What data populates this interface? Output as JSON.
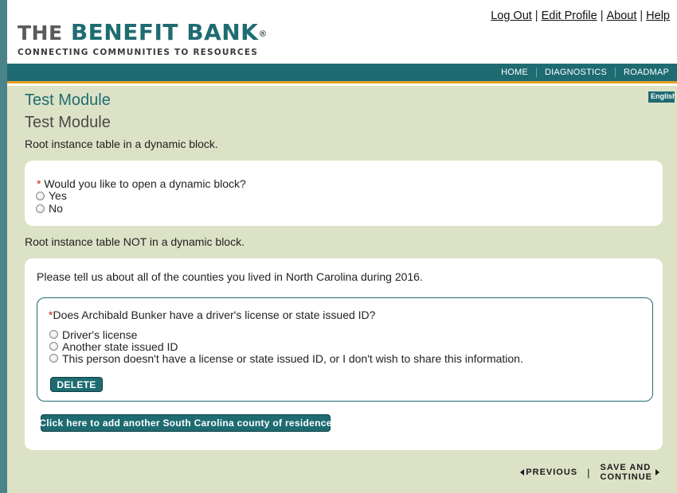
{
  "header": {
    "logo_the": "THE",
    "logo_main": "BENEFIT BANK",
    "logo_reg": "®",
    "logo_tagline": "CONNECTING COMMUNITIES TO RESOURCES",
    "links": [
      "Log Out",
      "Edit Profile",
      "About",
      "Help"
    ],
    "link_separator": "|"
  },
  "nav": {
    "items": [
      "HOME",
      "DIAGNOSTICS",
      "ROADMAP"
    ]
  },
  "language_button": "English",
  "page": {
    "title_primary": "Test Module",
    "title_secondary": "Test Module",
    "section1_description": "Root instance table in a dynamic block.",
    "section2_description": "Root instance table NOT in a dynamic block."
  },
  "card1": {
    "required_mark": "*",
    "question": " Would you like to open a dynamic block?",
    "options": [
      "Yes",
      "No"
    ]
  },
  "card2": {
    "intro": "Please tell us about all of the counties you lived in North Carolina during 2016.",
    "inner": {
      "required_mark": "*",
      "question": "Does Archibald Bunker have a driver's license or state issued ID?",
      "options": [
        "Driver's license",
        "Another state issued ID",
        "This person doesn't have a license or state issued ID, or I don't wish to share this information."
      ],
      "delete_label": "DELETE"
    },
    "add_label": "Click here to add another South Carolina county of residence"
  },
  "footer": {
    "previous_label": "PREVIOUS",
    "separator": "|",
    "next_line1": "SAVE AND",
    "next_line2": "CONTINUE"
  },
  "colors": {
    "brand_teal": "#1e6c72",
    "accent_orange": "#e8a020",
    "content_bg": "#dce2c6",
    "required_red": "#cc1e1e"
  }
}
